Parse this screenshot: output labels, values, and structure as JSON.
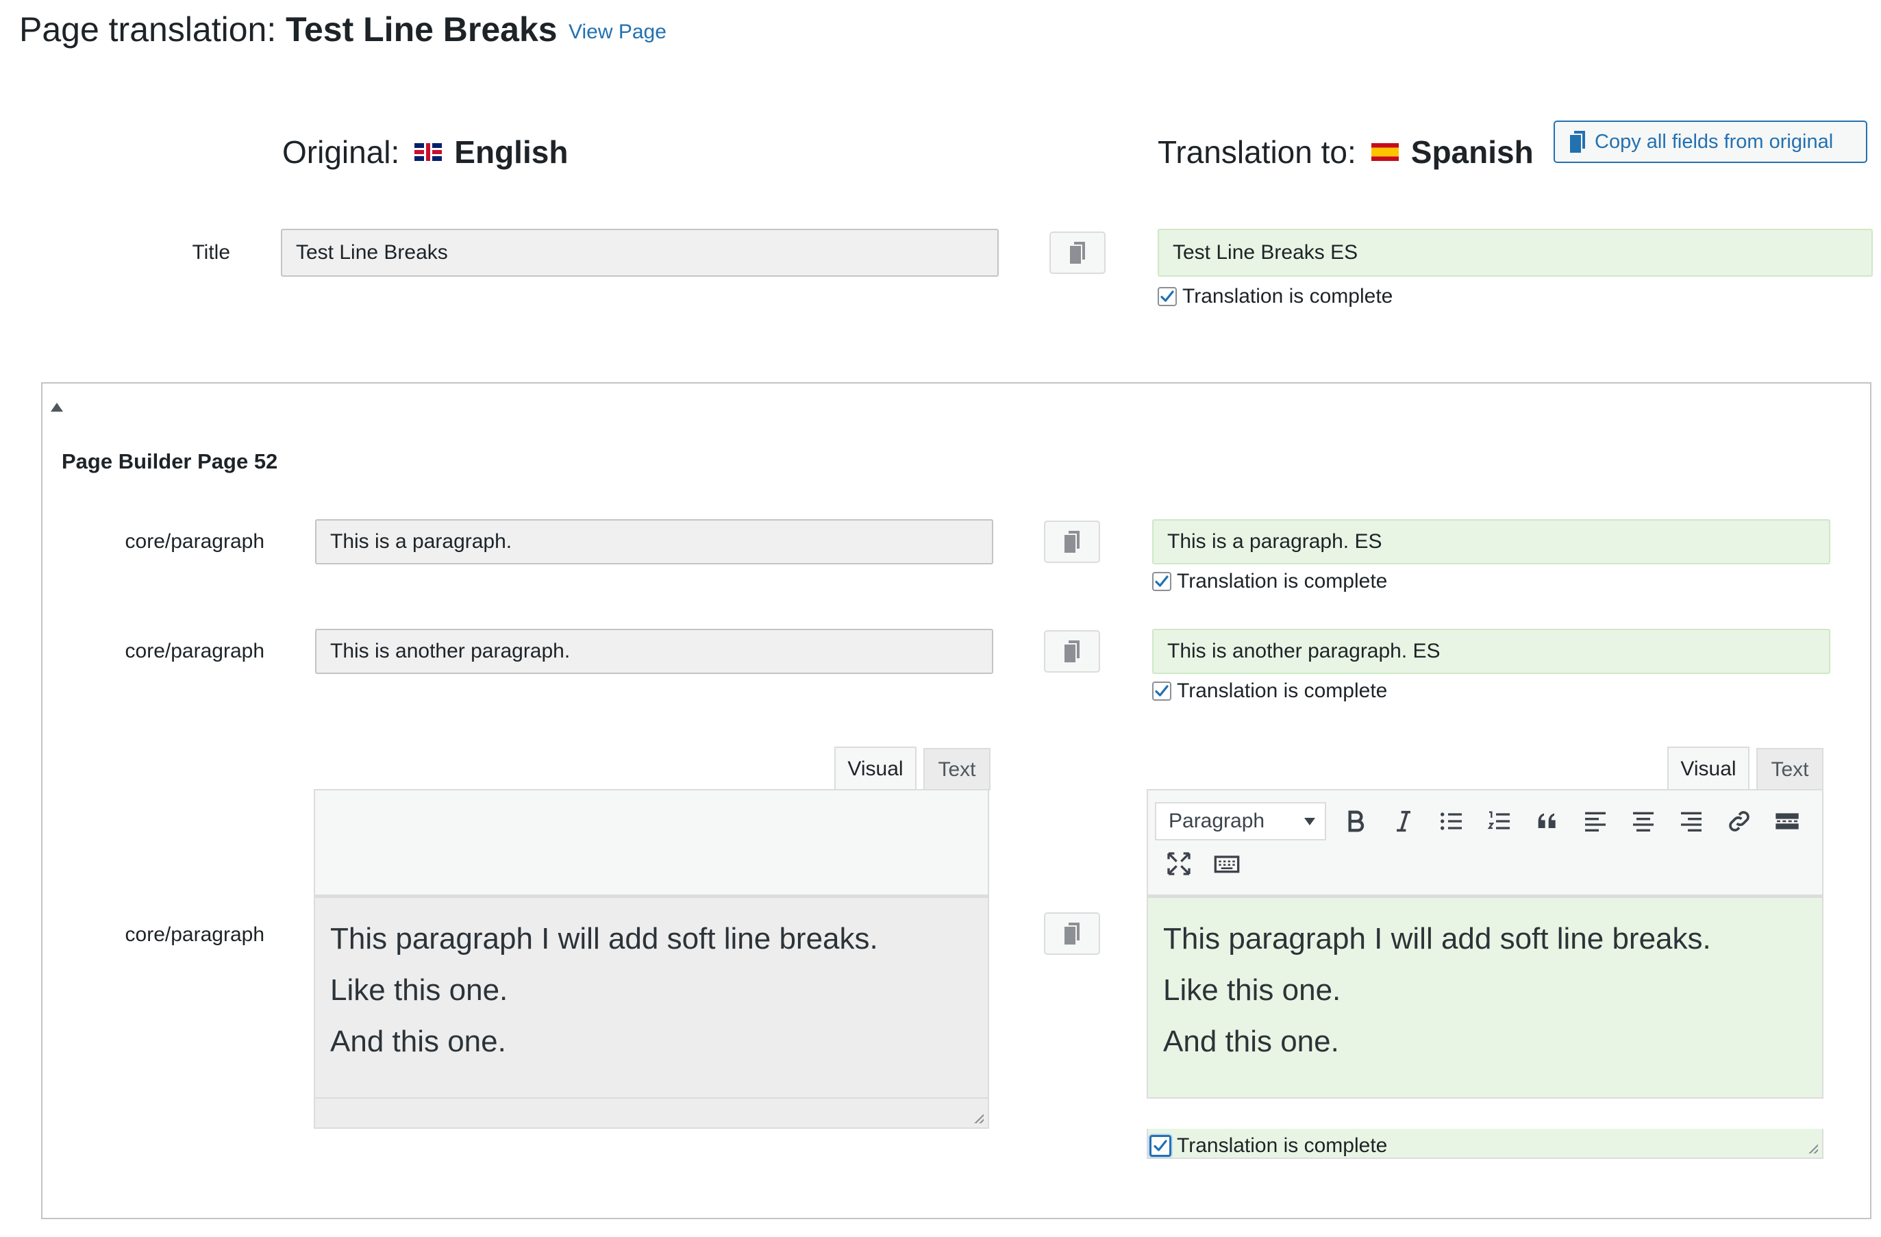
{
  "header": {
    "prefix": "Page translation: ",
    "page_title": "Test Line Breaks",
    "view_link": "View Page"
  },
  "columns": {
    "original_label": "Original:",
    "original_language": "English",
    "translation_label": "Translation to:",
    "translation_language": "Spanish"
  },
  "copy_all_label": "Copy all fields from original",
  "title_row": {
    "label": "Title",
    "original": "Test Line Breaks",
    "translation": "Test Line Breaks ES",
    "complete_label": "Translation is complete",
    "complete": true
  },
  "panel": {
    "title": "Page Builder Page 52",
    "rows": [
      {
        "label": "core/paragraph",
        "original": "This is a paragraph.",
        "translation": "This is a paragraph. ES",
        "complete_label": "Translation is complete",
        "complete": true
      },
      {
        "label": "core/paragraph",
        "original": "This is another paragraph.",
        "translation": "This is another paragraph. ES",
        "complete_label": "Translation is complete",
        "complete": true
      }
    ],
    "editor_row": {
      "label": "core/paragraph",
      "tab_visual": "Visual",
      "tab_text": "Text",
      "format_select": "Paragraph",
      "original_lines": [
        "This paragraph I will add soft line breaks.",
        "Like this one.",
        "And this one."
      ],
      "translation_lines": [
        "This paragraph I will add soft line breaks.",
        "Like this one.",
        "And this one."
      ],
      "complete_label": "Translation is complete",
      "complete": true
    }
  },
  "colors": {
    "link": "#2271b1",
    "target_field_bg": "#e9f5e4",
    "source_field_bg": "#f0f0f1"
  }
}
